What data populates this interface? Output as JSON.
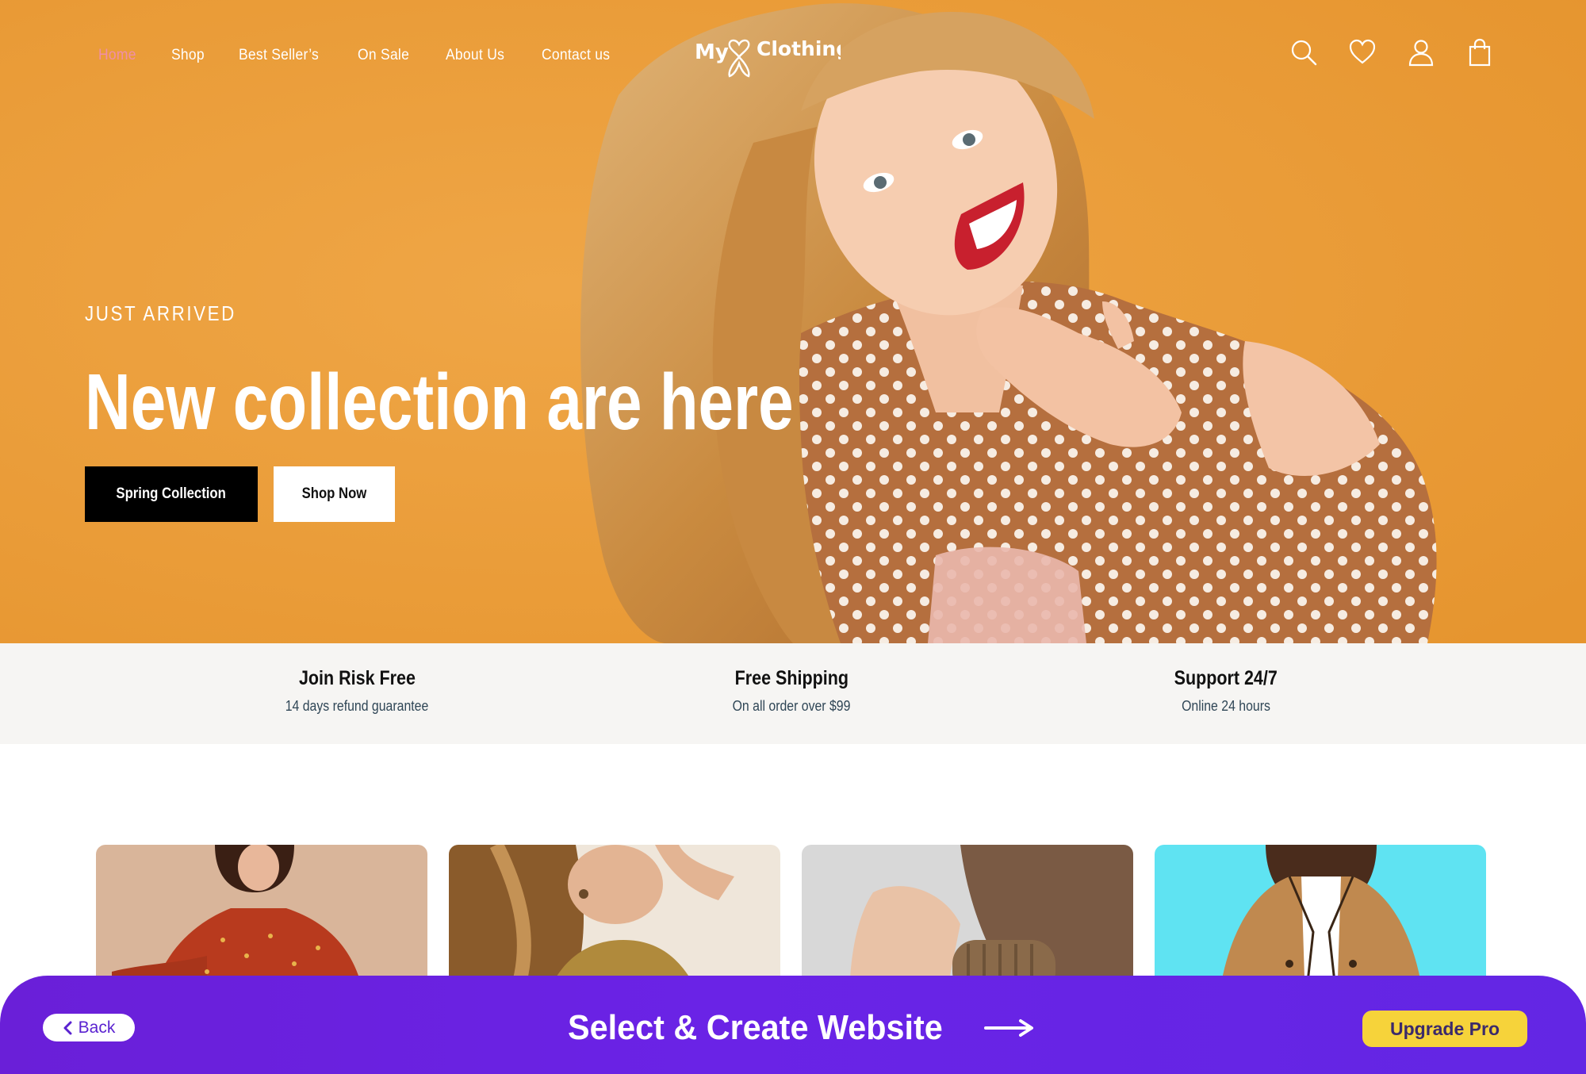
{
  "nav": {
    "items": [
      {
        "label": "Home",
        "active": true
      },
      {
        "label": "Shop"
      },
      {
        "label": "Best Seller’s"
      },
      {
        "label": "On Sale"
      },
      {
        "label": "About Us"
      },
      {
        "label": "Contact us"
      }
    ],
    "active_color": "#f08ea8"
  },
  "logo": {
    "text_left": "My",
    "text_right": "Clothing"
  },
  "header_icons": [
    "search-icon",
    "heart-icon",
    "user-icon",
    "shopping-bag-icon"
  ],
  "hero": {
    "eyebrow": "JUST ARRIVED",
    "headline": "New collection are here",
    "primary_cta": "Spring Collection",
    "secondary_cta": "Shop Now",
    "background_color": "#e89b38"
  },
  "features": [
    {
      "title": "Join Risk Free",
      "subtitle": "14 days refund guarantee"
    },
    {
      "title": "Free Shipping",
      "subtitle": "On all order over $99"
    },
    {
      "title": "Support 24/7",
      "subtitle": "Online 24 hours"
    }
  ],
  "product_cards": [
    "card-1",
    "card-2",
    "card-3",
    "card-4"
  ],
  "bottom_bar": {
    "back_label": "Back",
    "title": "Select & Create Website",
    "upgrade_label": "Upgrade Pro",
    "accent_color": "#6a1fd8",
    "upgrade_color": "#f6d33a"
  }
}
